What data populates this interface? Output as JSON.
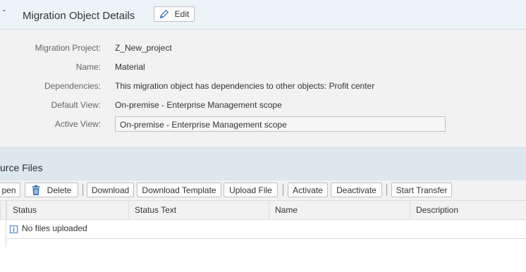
{
  "header": {
    "title": "Migration Object Details",
    "edit_label": "Edit"
  },
  "details": {
    "rows": [
      {
        "label": "Migration Project:",
        "value": "Z_New_project"
      },
      {
        "label": "Name:",
        "value": "Material"
      },
      {
        "label": "Dependencies:",
        "value": "This migration object has dependencies to other objects: Profit center"
      },
      {
        "label": "Default View:",
        "value": "On-premise - Enterprise Management scope"
      },
      {
        "label": "Active View:",
        "value": "On-premise - Enterprise Management scope"
      }
    ]
  },
  "source_files": {
    "title": "urce Files",
    "toolbar": {
      "open": "pen",
      "delete": "Delete",
      "download": "Download",
      "download_template": "Download Template",
      "upload_file": "Upload File",
      "activate": "Activate",
      "deactivate": "Deactivate",
      "start_transfer": "Start Transfer"
    },
    "columns": [
      "Status",
      "Status Text",
      "Name",
      "Description"
    ],
    "empty_message": "No files uploaded"
  },
  "colors": {
    "header_bg": "#edf4f8",
    "section_bg": "#dce7ee",
    "info_icon": "#3a7bc8"
  },
  "icons": {
    "edit": "pencil-icon",
    "delete": "trash-icon",
    "info": "info-icon"
  }
}
